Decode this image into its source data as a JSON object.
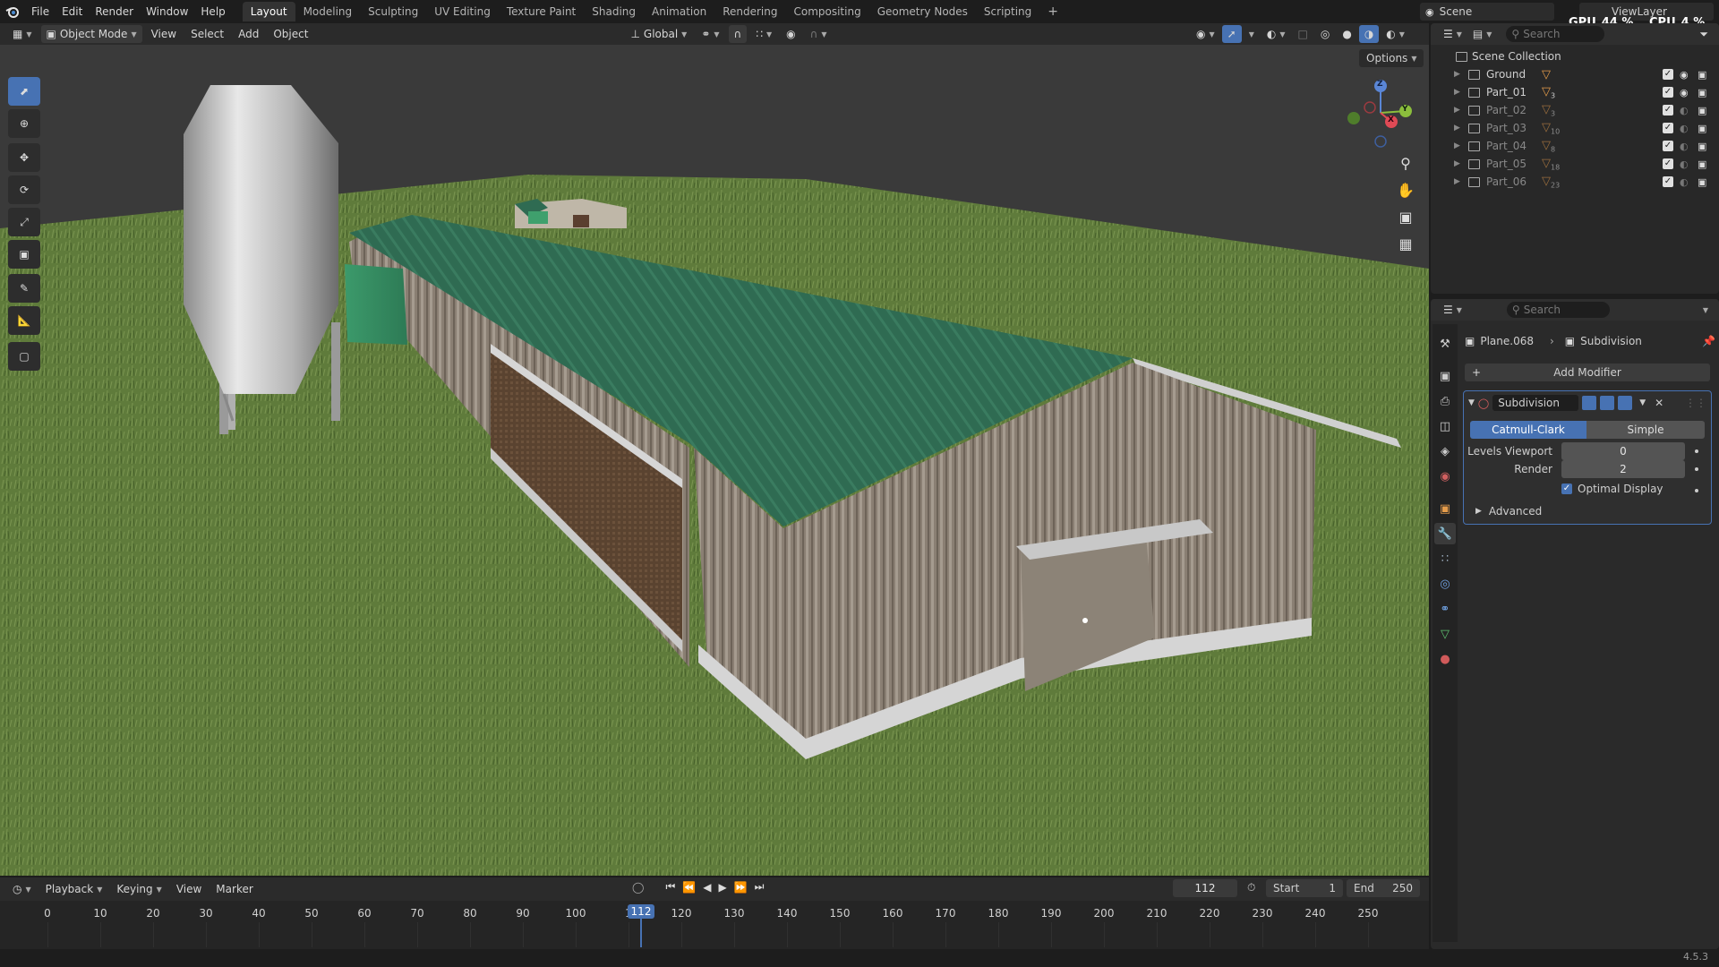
{
  "topbar": {
    "menu": [
      "File",
      "Edit",
      "Render",
      "Window",
      "Help"
    ],
    "workspaces": [
      "Layout",
      "Modeling",
      "Sculpting",
      "UV Editing",
      "Texture Paint",
      "Shading",
      "Animation",
      "Rendering",
      "Compositing",
      "Geometry Nodes",
      "Scripting"
    ],
    "active_workspace": "Layout",
    "add_tab": "+",
    "scene": "Scene",
    "view_layer": "ViewLayer",
    "gpu_label": "GPU",
    "gpu_value": "44 %",
    "cpu_label": "CPU",
    "cpu_value": "4 %"
  },
  "viewport_header": {
    "mode": "Object Mode",
    "menus": [
      "View",
      "Select",
      "Add",
      "Object"
    ],
    "orientation": "Global",
    "options": "Options"
  },
  "gizmo": {
    "z": "Z",
    "y": "Y",
    "x": "X"
  },
  "outliner": {
    "search_placeholder": "Search",
    "root": "Scene Collection",
    "items": [
      {
        "name": "Ground",
        "count": ""
      },
      {
        "name": "Part_01",
        "count": "3"
      },
      {
        "name": "Part_02",
        "count": "3"
      },
      {
        "name": "Part_03",
        "count": "10"
      },
      {
        "name": "Part_04",
        "count": "8"
      },
      {
        "name": "Part_05",
        "count": "18"
      },
      {
        "name": "Part_06",
        "count": "23"
      }
    ]
  },
  "properties": {
    "search_placeholder": "Search",
    "object": "Plane.068",
    "modifier_context": "Subdivision",
    "add_modifier": "Add Modifier",
    "modifier_name": "Subdivision",
    "algorithm_options": [
      "Catmull-Clark",
      "Simple"
    ],
    "algorithm_selected": "Catmull-Clark",
    "levels_viewport_label": "Levels Viewport",
    "levels_viewport_value": "0",
    "render_label": "Render",
    "render_value": "2",
    "optimal_display_label": "Optimal Display",
    "optimal_display_checked": true,
    "advanced_label": "Advanced"
  },
  "timeline": {
    "menus": [
      "Playback",
      "Keying",
      "View",
      "Marker"
    ],
    "current_frame": "112",
    "start_label": "Start",
    "start_value": "1",
    "end_label": "End",
    "end_value": "250",
    "ruler": [
      "0",
      "10",
      "20",
      "30",
      "40",
      "50",
      "60",
      "70",
      "80",
      "90",
      "100",
      "1",
      "120",
      "130",
      "140",
      "150",
      "160",
      "170",
      "180",
      "190",
      "200",
      "210",
      "220",
      "230",
      "240",
      "250"
    ]
  },
  "status": {
    "version": "4.5.3"
  },
  "colors": {
    "accent": "#4772b3",
    "roof": "#2f6b52",
    "grass": "#5e7a3c",
    "sky": "#3a3a3a"
  },
  "icons": [
    "blender-logo-icon",
    "select-box-icon",
    "cursor-icon",
    "move-icon",
    "rotate-icon",
    "scale-icon",
    "transform-icon",
    "annotate-icon",
    "measure-icon",
    "add-cube-icon",
    "zoom-icon",
    "hand-icon",
    "camera-icon",
    "grid-icon",
    "eye-icon",
    "camera-render-icon",
    "wrench-icon"
  ]
}
